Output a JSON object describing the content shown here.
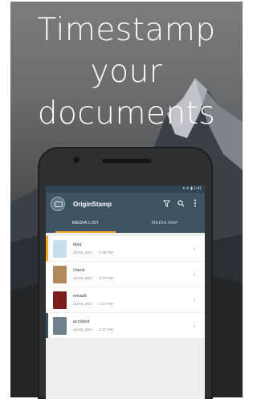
{
  "headline": {
    "line1": "Timestamp",
    "line2": "your",
    "line3": "documents"
  },
  "statusbar": {
    "time": "▾ ✈ ▮ 1:41"
  },
  "app": {
    "title": "OriginStamp"
  },
  "toolbar": {
    "filter_icon": "filter-icon",
    "search_icon": "search-icon",
    "more_icon": "more-vert-icon"
  },
  "tabs": [
    {
      "label": "MEDIA LIST",
      "active": true
    },
    {
      "label": "MEDIA MAP",
      "active": false
    }
  ],
  "items": [
    {
      "name": "idea",
      "date": "Jul 25, 2017",
      "time": "1:38 PM",
      "accent": "#f5a623",
      "thumb": "#c8dff0"
    },
    {
      "name": "check",
      "date": "Jul 25, 2017",
      "time": "1:37 PM",
      "accent": "#ffffff",
      "thumb": "#b08a5c"
    },
    {
      "name": "renault",
      "date": "Jul 25, 2017",
      "time": "1:37 PM",
      "accent": "#ffffff",
      "thumb": "#7c1d1d"
    },
    {
      "name": "accident",
      "date": "Jul 25, 2017",
      "time": "1:37 PM",
      "accent": "#3d5362",
      "thumb": "#6f7f8c"
    }
  ],
  "chevron": "›"
}
